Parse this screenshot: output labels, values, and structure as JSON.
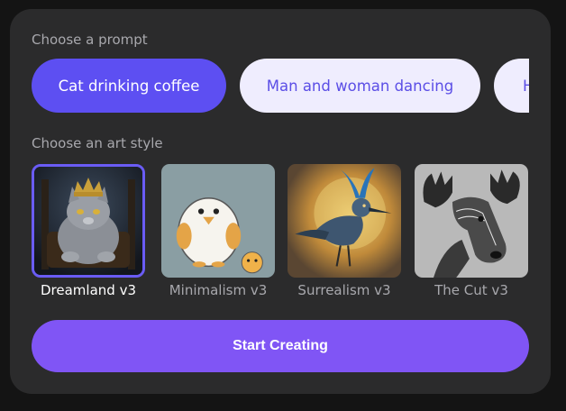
{
  "prompt_section": {
    "label": "Choose a prompt",
    "chips": [
      {
        "label": "Cat drinking coffee",
        "selected": true
      },
      {
        "label": "Man and woman dancing",
        "selected": false
      },
      {
        "label": "H",
        "selected": false
      }
    ]
  },
  "style_section": {
    "label": "Choose an art style",
    "styles": [
      {
        "name": "Dreamland v3",
        "image": "crowned-cat-on-throne",
        "selected": true
      },
      {
        "name": "Minimalism v3",
        "image": "cartoon-bird-with-chick",
        "selected": false
      },
      {
        "name": "Surrealism v3",
        "image": "blue-crested-bird",
        "selected": false
      },
      {
        "name": "The Cut v3",
        "image": "moose-engraving",
        "selected": false
      }
    ]
  },
  "start_button": {
    "label": "Start Creating"
  },
  "colors": {
    "accent": "#5d4ff2",
    "button": "#8055f5",
    "chip_idle_bg": "#efedfe",
    "panel": "#2b2b2c"
  }
}
